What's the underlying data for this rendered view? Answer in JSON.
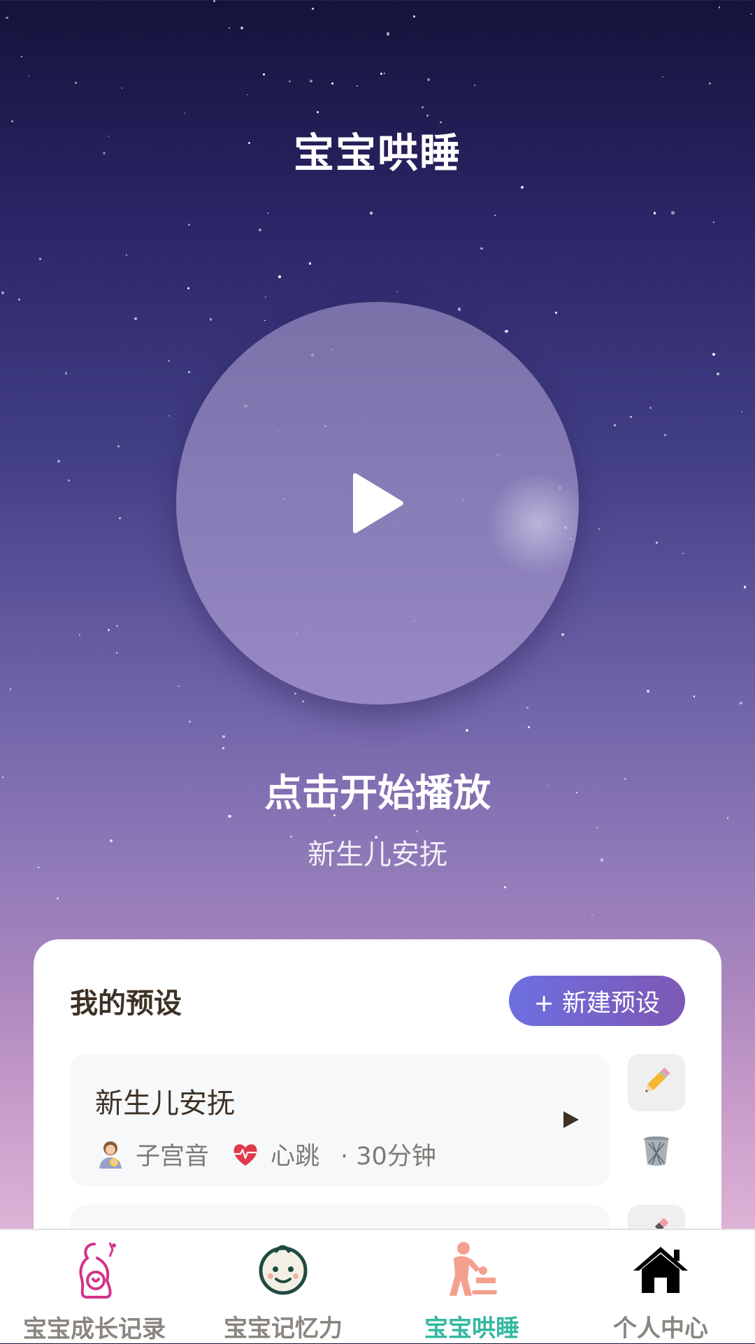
{
  "header": {
    "title": "宝宝哄睡"
  },
  "player": {
    "play_icon": "play-icon",
    "prompt": "点击开始播放",
    "current_preset": "新生儿安抚"
  },
  "presets": {
    "title": "我的预设",
    "new_button_label": "+ 新建预设",
    "items": [
      {
        "name": "新生儿安抚",
        "sounds": [
          {
            "icon": "woman-with-baby-icon",
            "label": "子宫音"
          },
          {
            "icon": "heart-icon",
            "label": "心跳"
          }
        ],
        "duration": "· 30分钟"
      }
    ]
  },
  "nav": {
    "items": [
      {
        "label": "宝宝成长记录",
        "icon": "pregnant-mother-icon",
        "active": false
      },
      {
        "label": "宝宝记忆力",
        "icon": "baby-face-icon",
        "active": false
      },
      {
        "label": "宝宝哄睡",
        "icon": "baby-care-icon",
        "active": true
      },
      {
        "label": "个人中心",
        "icon": "home-icon",
        "active": false
      }
    ]
  },
  "colors": {
    "accent": "#35b8a2",
    "button_gradient_start": "#6d6fe0",
    "button_gradient_end": "#7d58b4"
  }
}
